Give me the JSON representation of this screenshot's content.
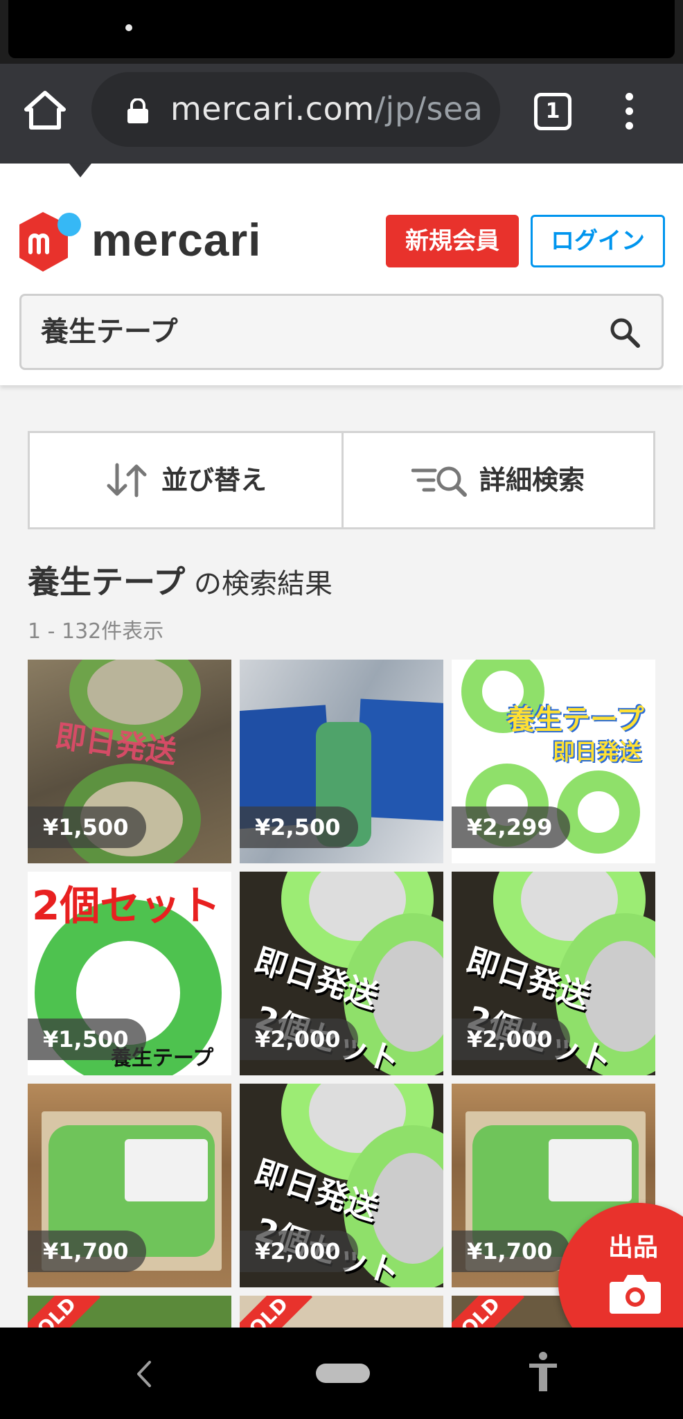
{
  "browser": {
    "url_main": "mercari.com",
    "url_path": "/jp/sea",
    "tab_count": "1"
  },
  "header": {
    "wordmark": "mercari",
    "register_label": "新規会員",
    "login_label": "ログイン",
    "search_value": "養生テープ"
  },
  "controls": {
    "sort_label": "並び替え",
    "filter_label": "詳細検索"
  },
  "results": {
    "keyword": "養生テープ",
    "title_suffix": " の検索結果",
    "count": "1 - 132件表示"
  },
  "items": [
    {
      "price": "¥1,500",
      "overlay": "即日発送"
    },
    {
      "price": "¥2,500",
      "overlay": ""
    },
    {
      "price": "¥2,299",
      "overlay": "養生テープ",
      "overlay2": "即日発送"
    },
    {
      "price": "¥1,500",
      "overlay": "2個セット",
      "overlay2": "養生テープ"
    },
    {
      "price": "¥2,000",
      "overlay": "即日発送",
      "overlay2": "2個セット"
    },
    {
      "price": "¥2,000",
      "overlay": "即日発送",
      "overlay2": "2個セット"
    },
    {
      "price": "¥1,700",
      "overlay": ""
    },
    {
      "price": "¥2,000",
      "overlay": "即日発送",
      "overlay2": "2個セット"
    },
    {
      "price": "¥1,700",
      "overlay": ""
    }
  ],
  "partial_items": [
    {
      "badge": "SOLD"
    },
    {
      "badge": "SOLD"
    },
    {
      "badge": "SOLD"
    }
  ],
  "fab": {
    "label": "出品"
  },
  "colors": {
    "brand_red": "#e8322c",
    "login_blue": "#0095ee",
    "tape_green": "#7bd65a"
  }
}
